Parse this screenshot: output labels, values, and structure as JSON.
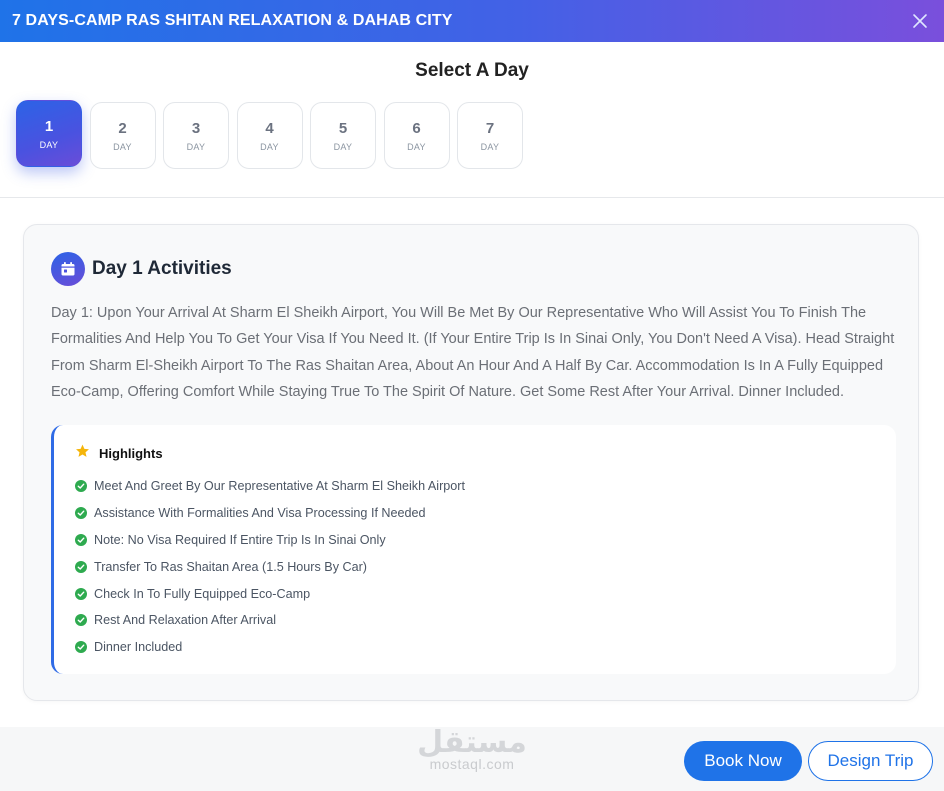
{
  "header": {
    "title": "7 DAYS-CAMP RAS SHITAN RELAXATION & DAHAB CITY",
    "close_icon": "close-icon"
  },
  "day_selector": {
    "title": "Select A Day",
    "days": [
      {
        "number": "1",
        "label": "DAY",
        "active": true
      },
      {
        "number": "2",
        "label": "DAY",
        "active": false
      },
      {
        "number": "3",
        "label": "DAY",
        "active": false
      },
      {
        "number": "4",
        "label": "DAY",
        "active": false
      },
      {
        "number": "5",
        "label": "DAY",
        "active": false
      },
      {
        "number": "6",
        "label": "DAY",
        "active": false
      },
      {
        "number": "7",
        "label": "DAY",
        "active": false
      }
    ]
  },
  "activities": {
    "icon": "calendar-icon",
    "title": "Day 1 Activities",
    "description": "Day 1: Upon Your Arrival At Sharm El Sheikh Airport, You Will Be Met By Our Representative Who Will Assist You To Finish The Formalities And Help You To Get Your Visa If You Need It. (If Your Entire Trip Is In Sinai Only, You Don't Need A Visa). Head Straight From Sharm El-Sheikh Airport To The Ras Shaitan Area, About An Hour And A Half By Car. Accommodation Is In A Fully Equipped Eco-Camp, Offering Comfort While Staying True To The Spirit Of Nature. Get Some Rest After Your Arrival. Dinner Included."
  },
  "highlights": {
    "icon": "star-icon",
    "title": "Highlights",
    "items": [
      "Meet And Greet By Our Representative At Sharm El Sheikh Airport",
      "Assistance With Formalities And Visa Processing If Needed",
      "Note: No Visa Required If Entire Trip Is In Sinai Only",
      "Transfer To Ras Shaitan Area (1.5 Hours By Car)",
      "Check In To Fully Equipped Eco-Camp",
      "Rest And Relaxation After Arrival",
      "Dinner Included"
    ]
  },
  "footer": {
    "watermark_arabic": "مستقل",
    "watermark_latin": "mostaql.com",
    "book_label": "Book Now",
    "design_label": "Design Trip"
  },
  "colors": {
    "primary": "#1f73e8",
    "accent_purple": "#6a4dd8",
    "check_green": "#2eaa4f",
    "star_yellow": "#f5b50a"
  }
}
